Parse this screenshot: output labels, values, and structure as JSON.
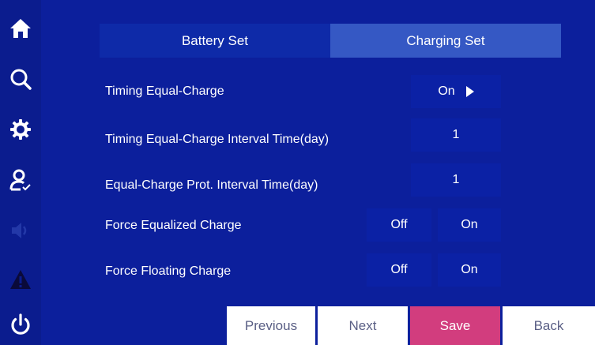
{
  "sidebar": {
    "icons": [
      "home-icon",
      "search-icon",
      "gear-icon",
      "user-check-icon",
      "speaker-icon",
      "warning-icon",
      "power-icon"
    ]
  },
  "tabs": {
    "battery_set": "Battery Set",
    "charging_set": "Charging Set",
    "active": "Charging Set"
  },
  "rows": {
    "timing_equal_charge": {
      "label": "Timing Equal-Charge",
      "value": "On"
    },
    "timing_interval": {
      "label": "Timing Equal-Charge Interval Time(day)",
      "value": "1"
    },
    "prot_interval": {
      "label": "Equal-Charge Prot. Interval Time(day)",
      "value": "1"
    },
    "force_equalized": {
      "label": "Force Equalized Charge",
      "off": "Off",
      "on": "On"
    },
    "force_floating": {
      "label": "Force Floating Charge",
      "off": "Off",
      "on": "On"
    }
  },
  "buttons": {
    "previous": "Previous",
    "next": "Next",
    "save": "Save",
    "back": "Back"
  },
  "colors": {
    "background": "#0c1f9c",
    "sidebar": "#0b1c8e",
    "active_tab": "#3558c4",
    "value_box": "#0b21a5",
    "save_button": "#d23d7e",
    "disabled_icon": "#2338a8"
  }
}
